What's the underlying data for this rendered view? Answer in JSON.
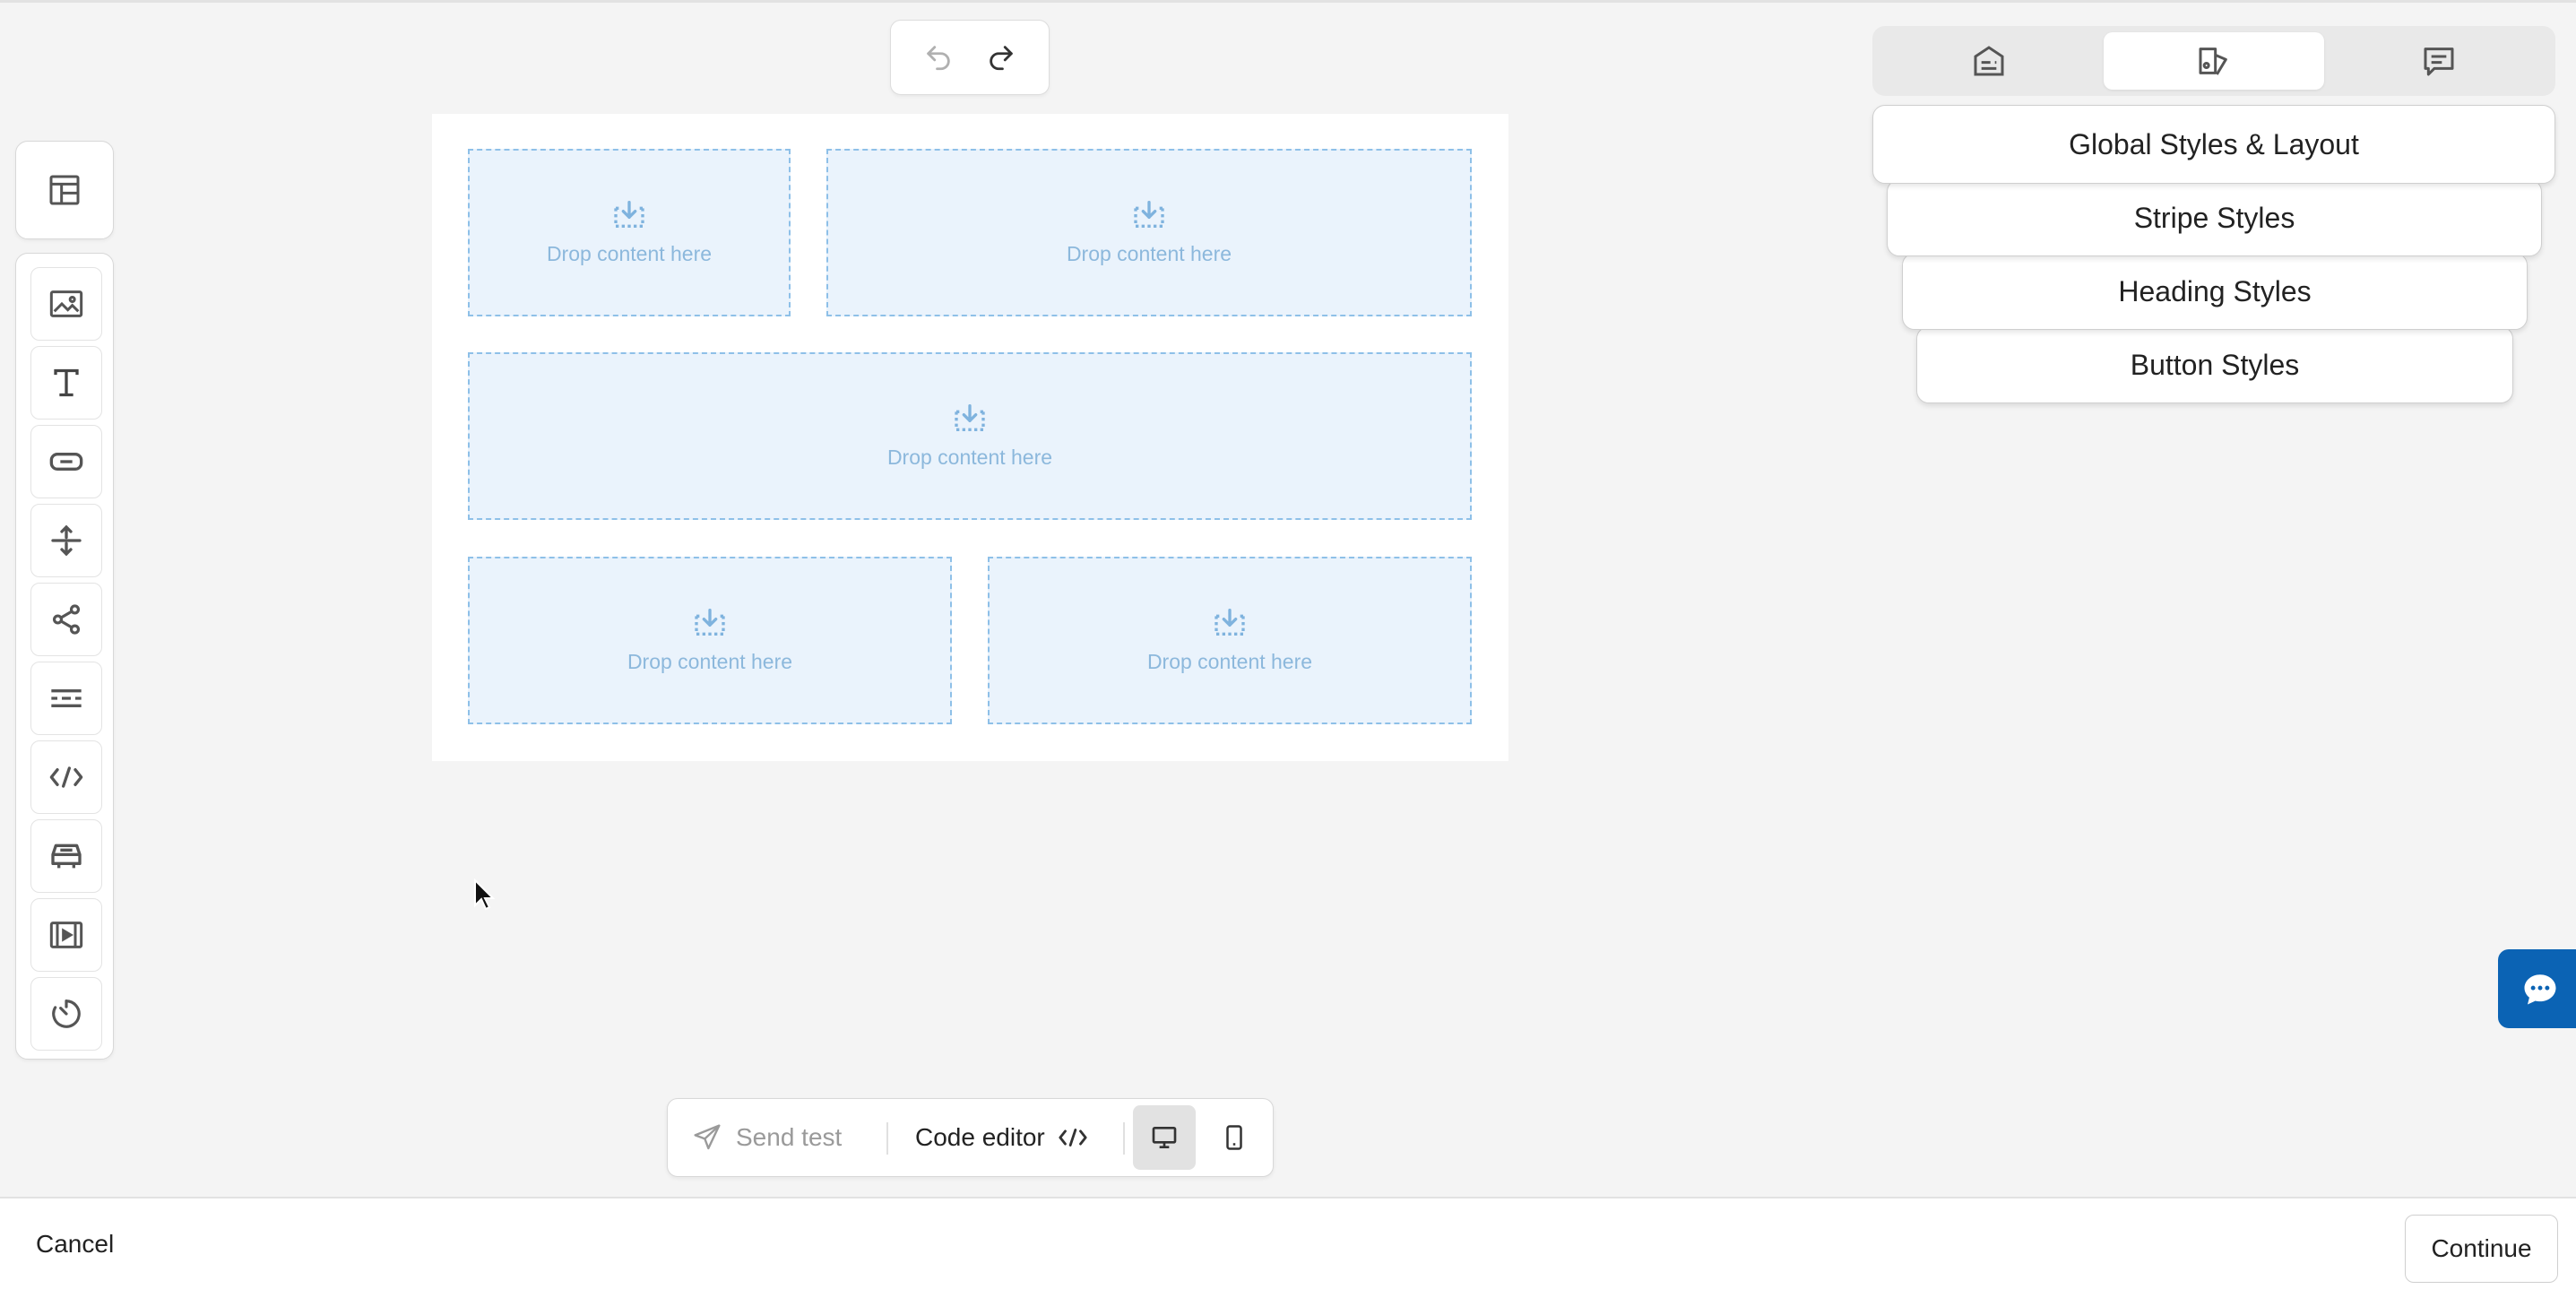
{
  "editor": {
    "drop_placeholder": "Drop content here",
    "undo_icon": "undo-icon",
    "redo_icon": "redo-icon"
  },
  "canvas": {
    "rows": [
      {
        "columns": [
          {
            "label": "Drop content here"
          },
          {
            "label": "Drop content here"
          }
        ]
      },
      {
        "columns": [
          {
            "label": "Drop content here"
          }
        ]
      },
      {
        "columns": [
          {
            "label": "Drop content here"
          },
          {
            "label": "Drop content here"
          }
        ]
      }
    ]
  },
  "sidebar": {
    "top_icon": "layout-grid-icon",
    "tools": [
      {
        "icon": "image-icon"
      },
      {
        "icon": "text-icon"
      },
      {
        "icon": "button-icon"
      },
      {
        "icon": "spacer-icon"
      },
      {
        "icon": "share-icon"
      },
      {
        "icon": "divider-icon"
      },
      {
        "icon": "code-icon"
      },
      {
        "icon": "product-icon"
      },
      {
        "icon": "video-icon"
      },
      {
        "icon": "timer-icon"
      }
    ]
  },
  "right_panel": {
    "tabs": [
      {
        "icon": "content-icon",
        "active": false
      },
      {
        "icon": "styles-icon",
        "active": true
      },
      {
        "icon": "comments-icon",
        "active": false
      }
    ],
    "style_buttons": [
      {
        "label": "Global Styles & Layout"
      },
      {
        "label": "Stripe Styles"
      },
      {
        "label": "Heading Styles"
      },
      {
        "label": "Button Styles"
      }
    ]
  },
  "bottom_toolbar": {
    "send_test": "Send test",
    "code_editor": "Code editor",
    "active_device": "desktop"
  },
  "footer": {
    "cancel": "Cancel",
    "continue": "Continue"
  },
  "colors": {
    "drop_fill": "#eaf3fc",
    "drop_border": "#8ec0e8",
    "chat_accent": "#0b63b4"
  }
}
